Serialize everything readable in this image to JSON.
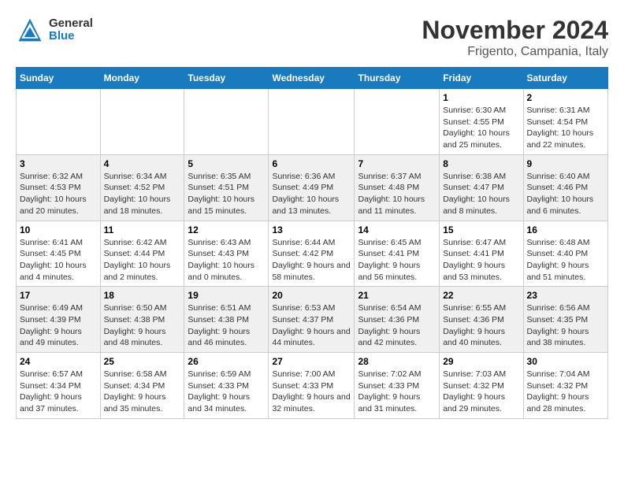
{
  "logo": {
    "general": "General",
    "blue": "Blue"
  },
  "title": "November 2024",
  "location": "Frigento, Campania, Italy",
  "days_of_week": [
    "Sunday",
    "Monday",
    "Tuesday",
    "Wednesday",
    "Thursday",
    "Friday",
    "Saturday"
  ],
  "weeks": [
    [
      {
        "day": "",
        "info": ""
      },
      {
        "day": "",
        "info": ""
      },
      {
        "day": "",
        "info": ""
      },
      {
        "day": "",
        "info": ""
      },
      {
        "day": "",
        "info": ""
      },
      {
        "day": "1",
        "info": "Sunrise: 6:30 AM\nSunset: 4:55 PM\nDaylight: 10 hours and 25 minutes."
      },
      {
        "day": "2",
        "info": "Sunrise: 6:31 AM\nSunset: 4:54 PM\nDaylight: 10 hours and 22 minutes."
      }
    ],
    [
      {
        "day": "3",
        "info": "Sunrise: 6:32 AM\nSunset: 4:53 PM\nDaylight: 10 hours and 20 minutes."
      },
      {
        "day": "4",
        "info": "Sunrise: 6:34 AM\nSunset: 4:52 PM\nDaylight: 10 hours and 18 minutes."
      },
      {
        "day": "5",
        "info": "Sunrise: 6:35 AM\nSunset: 4:51 PM\nDaylight: 10 hours and 15 minutes."
      },
      {
        "day": "6",
        "info": "Sunrise: 6:36 AM\nSunset: 4:49 PM\nDaylight: 10 hours and 13 minutes."
      },
      {
        "day": "7",
        "info": "Sunrise: 6:37 AM\nSunset: 4:48 PM\nDaylight: 10 hours and 11 minutes."
      },
      {
        "day": "8",
        "info": "Sunrise: 6:38 AM\nSunset: 4:47 PM\nDaylight: 10 hours and 8 minutes."
      },
      {
        "day": "9",
        "info": "Sunrise: 6:40 AM\nSunset: 4:46 PM\nDaylight: 10 hours and 6 minutes."
      }
    ],
    [
      {
        "day": "10",
        "info": "Sunrise: 6:41 AM\nSunset: 4:45 PM\nDaylight: 10 hours and 4 minutes."
      },
      {
        "day": "11",
        "info": "Sunrise: 6:42 AM\nSunset: 4:44 PM\nDaylight: 10 hours and 2 minutes."
      },
      {
        "day": "12",
        "info": "Sunrise: 6:43 AM\nSunset: 4:43 PM\nDaylight: 10 hours and 0 minutes."
      },
      {
        "day": "13",
        "info": "Sunrise: 6:44 AM\nSunset: 4:42 PM\nDaylight: 9 hours and 58 minutes."
      },
      {
        "day": "14",
        "info": "Sunrise: 6:45 AM\nSunset: 4:41 PM\nDaylight: 9 hours and 56 minutes."
      },
      {
        "day": "15",
        "info": "Sunrise: 6:47 AM\nSunset: 4:41 PM\nDaylight: 9 hours and 53 minutes."
      },
      {
        "day": "16",
        "info": "Sunrise: 6:48 AM\nSunset: 4:40 PM\nDaylight: 9 hours and 51 minutes."
      }
    ],
    [
      {
        "day": "17",
        "info": "Sunrise: 6:49 AM\nSunset: 4:39 PM\nDaylight: 9 hours and 49 minutes."
      },
      {
        "day": "18",
        "info": "Sunrise: 6:50 AM\nSunset: 4:38 PM\nDaylight: 9 hours and 48 minutes."
      },
      {
        "day": "19",
        "info": "Sunrise: 6:51 AM\nSunset: 4:38 PM\nDaylight: 9 hours and 46 minutes."
      },
      {
        "day": "20",
        "info": "Sunrise: 6:53 AM\nSunset: 4:37 PM\nDaylight: 9 hours and 44 minutes."
      },
      {
        "day": "21",
        "info": "Sunrise: 6:54 AM\nSunset: 4:36 PM\nDaylight: 9 hours and 42 minutes."
      },
      {
        "day": "22",
        "info": "Sunrise: 6:55 AM\nSunset: 4:36 PM\nDaylight: 9 hours and 40 minutes."
      },
      {
        "day": "23",
        "info": "Sunrise: 6:56 AM\nSunset: 4:35 PM\nDaylight: 9 hours and 38 minutes."
      }
    ],
    [
      {
        "day": "24",
        "info": "Sunrise: 6:57 AM\nSunset: 4:34 PM\nDaylight: 9 hours and 37 minutes."
      },
      {
        "day": "25",
        "info": "Sunrise: 6:58 AM\nSunset: 4:34 PM\nDaylight: 9 hours and 35 minutes."
      },
      {
        "day": "26",
        "info": "Sunrise: 6:59 AM\nSunset: 4:33 PM\nDaylight: 9 hours and 34 minutes."
      },
      {
        "day": "27",
        "info": "Sunrise: 7:00 AM\nSunset: 4:33 PM\nDaylight: 9 hours and 32 minutes."
      },
      {
        "day": "28",
        "info": "Sunrise: 7:02 AM\nSunset: 4:33 PM\nDaylight: 9 hours and 31 minutes."
      },
      {
        "day": "29",
        "info": "Sunrise: 7:03 AM\nSunset: 4:32 PM\nDaylight: 9 hours and 29 minutes."
      },
      {
        "day": "30",
        "info": "Sunrise: 7:04 AM\nSunset: 4:32 PM\nDaylight: 9 hours and 28 minutes."
      }
    ]
  ]
}
